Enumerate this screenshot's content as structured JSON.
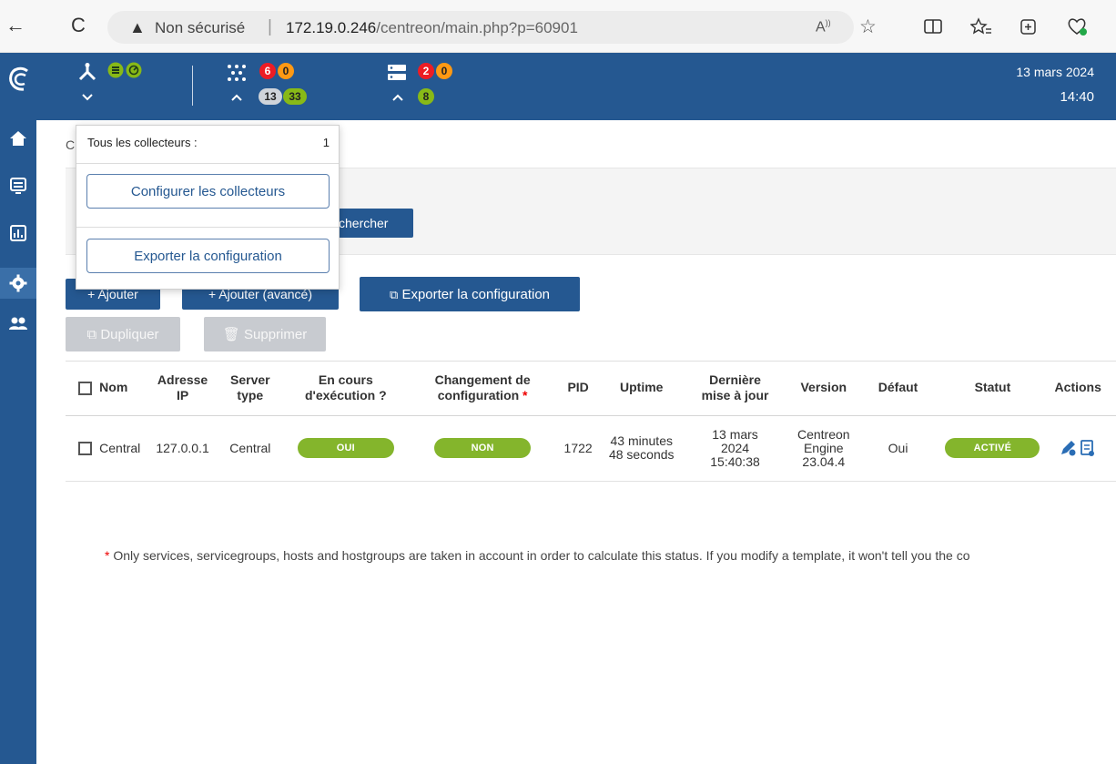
{
  "browser": {
    "back_icon": "←",
    "reload_icon": "C",
    "insecure_label": "Non sécurisé",
    "url_host": "172.19.0.246",
    "url_path": "/centreon/main.php?p=60901"
  },
  "sidebar": {
    "items": [
      "home-icon",
      "monitoring-icon",
      "reporting-icon",
      "configuration-icon",
      "administration-icon"
    ],
    "active": "configuration-icon"
  },
  "header": {
    "services_badges": {
      "critical": "6",
      "warning": "0",
      "unknown": "13",
      "ok": "33"
    },
    "hosts_badges": {
      "down": "2",
      "unreachable": "0",
      "up": "8"
    },
    "date": "13 mars 2024",
    "time": "14:40"
  },
  "breadcrumb": "C",
  "toolbar": {
    "search_label": "chercher",
    "add_label": "+ Ajouter",
    "add_advanced_label": "+ Ajouter (avancé)",
    "export_label": "Exporter la configuration",
    "duplicate_label": "Dupliquer",
    "delete_label": "Supprimer"
  },
  "table": {
    "headers": {
      "name": "Nom",
      "ip_1": "Adresse",
      "ip_2": "IP",
      "type_1": "Server",
      "type_2": "type",
      "running_1": "En cours",
      "running_2": "d'exécution ?",
      "change_1": "Changement de",
      "change_2": "configuration",
      "pid": "PID",
      "uptime": "Uptime",
      "last_1": "Dernière",
      "last_2": "mise à jour",
      "version": "Version",
      "default": "Défaut",
      "status": "Statut",
      "actions": "Actions"
    },
    "rows": [
      {
        "name": "Central",
        "ip": "127.0.0.1",
        "type": "Central",
        "running": "OUI",
        "change": "NON",
        "pid": "1722",
        "uptime_1": "43 minutes",
        "uptime_2": "48 seconds",
        "last_1": "13 mars",
        "last_2": "2024",
        "last_3": "15:40:38",
        "version_1": "Centreon",
        "version_2": "Engine",
        "version_3": "23.04.4",
        "default": "Oui",
        "status": "ACTIVÉ"
      }
    ]
  },
  "footnote": "Only services, servicegroups, hosts and hostgroups are taken in account in order to calculate this status. If you modify a template, it won't tell you the co",
  "dropdown": {
    "all_pollers_label": "Tous les collecteurs :",
    "all_pollers_count": "1",
    "configure_label": "Configurer les collecteurs",
    "export_label": "Exporter la configuration"
  },
  "colors": {
    "brand_blue": "#255891",
    "ok_green": "#84b52c",
    "critical_red": "#ed1c24",
    "warning_orange": "#ff9913"
  }
}
